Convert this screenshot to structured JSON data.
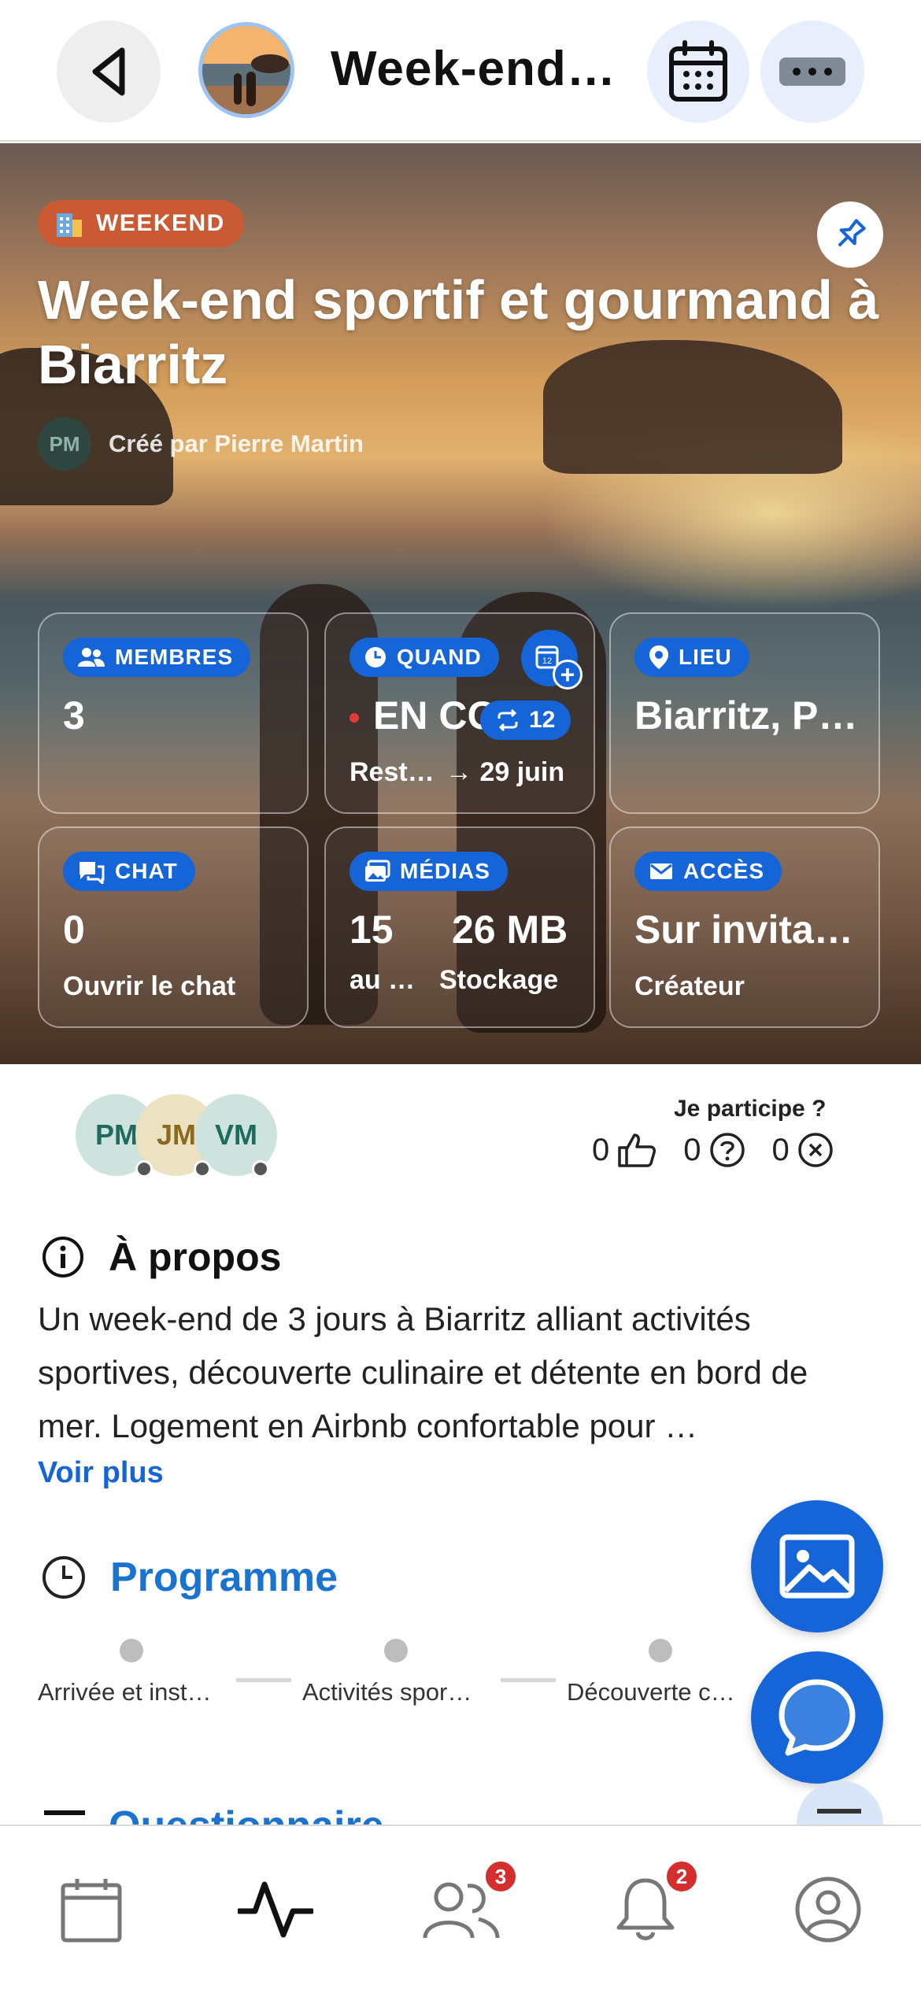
{
  "header": {
    "title": "Week-end…",
    "back_icon": "chevron-left-icon",
    "calendar_icon": "calendar-icon",
    "more_icon": "more-icon"
  },
  "hero": {
    "badge": "WEEKEND",
    "badge_color": "#c95a34",
    "title": "Week-end sportif et gourmand à Biarritz",
    "creator_initials": "PM",
    "creator_text": "Créé par Pierre Martin",
    "cards": {
      "members": {
        "label": "MEMBRES",
        "value": "3"
      },
      "when": {
        "label": "QUAND",
        "value": "EN CO",
        "recurrence": "12",
        "sub_left": "Rest…",
        "sub_right": "→ 29 juin",
        "calendar_badge": "12"
      },
      "place": {
        "label": "LIEU",
        "value": "Biarritz, P…"
      },
      "chat": {
        "label": "CHAT",
        "value": "0",
        "sub": "Ouvrir le chat"
      },
      "media": {
        "label": "MÉDIAS",
        "count": "15",
        "count_sub": "au …",
        "storage": "26 MB",
        "storage_sub": "Stockage"
      },
      "access": {
        "label": "ACCÈS",
        "value": "Sur invita…",
        "sub": "Créateur"
      }
    },
    "accent": "#1565d8"
  },
  "participants": {
    "avatars": [
      "PM",
      "JM",
      "VM"
    ],
    "question": "Je participe ?",
    "yes": "0",
    "maybe": "0",
    "no": "0"
  },
  "about": {
    "title": "À propos",
    "text": "Un week-end de 3 jours à Biarritz alliant activités sportives, découverte culinaire et détente en bord de mer. Logement en Airbnb confortable pour …",
    "more": "Voir plus"
  },
  "program": {
    "title": "Programme",
    "steps": [
      "Arrivée et inst…",
      "Activités spor…",
      "Découverte c…"
    ]
  },
  "questionnaire": {
    "title": "Questionnaire"
  },
  "nav": {
    "members_badge": "3",
    "notifications_badge": "2"
  }
}
